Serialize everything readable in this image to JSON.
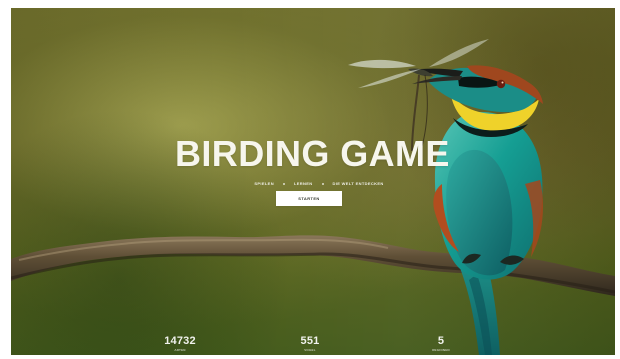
{
  "hero": {
    "title": "BIRDING GAME",
    "menu_links": [
      "SPIELEN",
      "LERNEN",
      "DIE WELT ENTDECKEN"
    ],
    "start_button_label": "STARTEN"
  },
  "stats": [
    {
      "number": "14732",
      "label": "ARTEN"
    },
    {
      "number": "551",
      "label": "VOGEL"
    },
    {
      "number": "5",
      "label": "REGIONEN"
    }
  ],
  "colors": {
    "background_green": "#5f6326",
    "title_white": "#f7f6ed",
    "button_white": "#ffffff",
    "bird_turquoise": "#1b9b8f",
    "bird_yellow": "#f2d61c",
    "bird_rust": "#9d4b1f",
    "branch_brown": "#5a4a32"
  },
  "icons": {
    "background_image": "bird-on-branch-photo-icon"
  }
}
